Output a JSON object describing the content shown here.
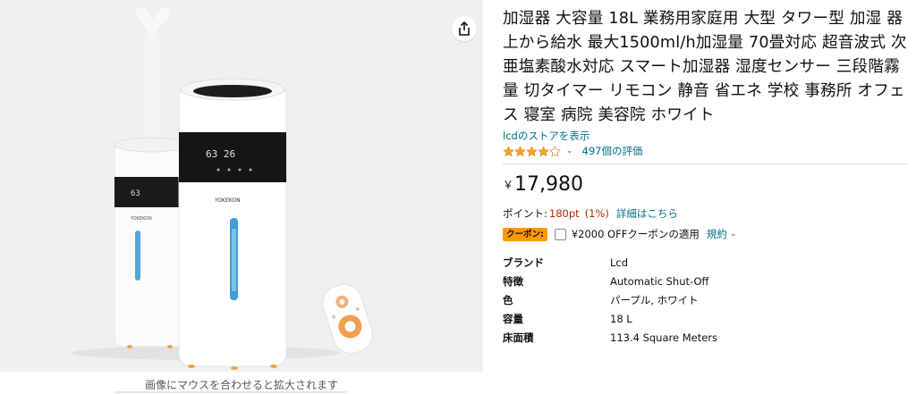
{
  "gallery": {
    "zoom_hint": "画像にマウスを合わせると拡大されます",
    "brand_on_unit": "YOKEKON",
    "display_readout": "63 26",
    "small_display_readout": "63"
  },
  "product": {
    "title": "加湿器 大容量 18L 業務用家庭用 大型 タワー型 加湿 器 上から給水 最大1500ml/h加湿量 70畳対応 超音波式 次亜塩素酸水対応 スマート加湿器 湿度センサー 三段階霧量 切タイマー リモコン 静音 省エネ 学校 事務所 オフェス 寝室 病院 美容院 ホワイト",
    "store_link": "lcdのストアを表示",
    "rating_stars": 4,
    "rating_count": "497個の評価",
    "price_symbol": "￥",
    "price": "17,980",
    "points_label": "ポイント:",
    "points_value": "180pt",
    "points_percent": "(1%)",
    "points_link": "詳細はこちら",
    "coupon_badge": "クーポン:",
    "coupon_text": "¥2000 OFFクーポンの適用",
    "coupon_terms": "規約"
  },
  "specs": [
    {
      "key": "ブランド",
      "value": "Lcd"
    },
    {
      "key": "特徴",
      "value": "Automatic Shut-Off"
    },
    {
      "key": "色",
      "value": "パープル, ホワイト"
    },
    {
      "key": "容量",
      "value": "18 L"
    },
    {
      "key": "床面積",
      "value": "113.4 Square Meters"
    }
  ],
  "colors": {
    "link": "#007185",
    "price_red": "#B12704",
    "star": "#FFA41C",
    "coupon": "#FF9900"
  }
}
